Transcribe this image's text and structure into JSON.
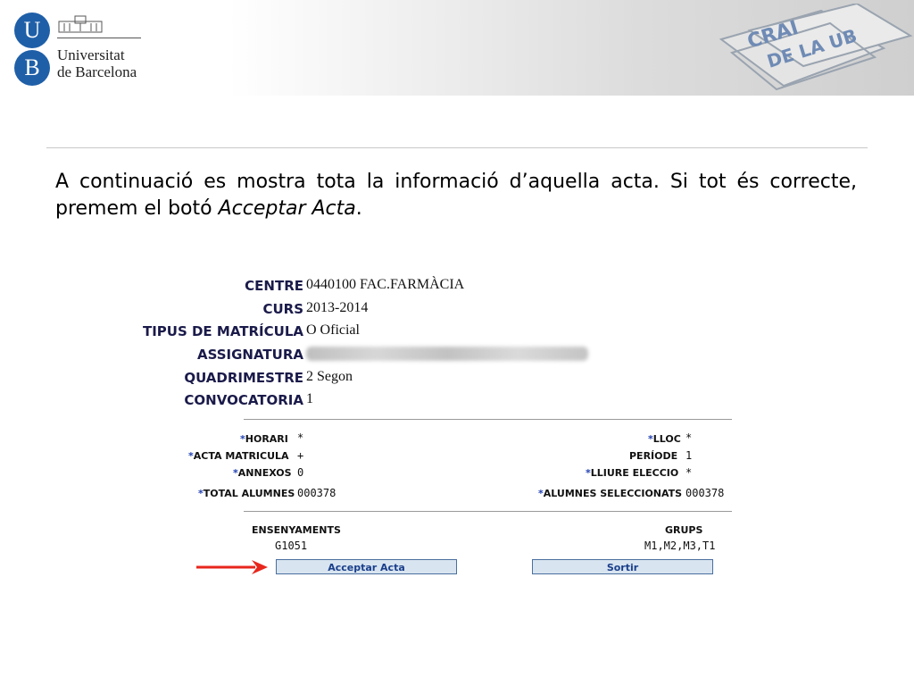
{
  "header": {
    "university_logo_letters": [
      "U",
      "B"
    ],
    "university_name_line1": "Universitat",
    "university_name_line2": "de Barcelona",
    "crai_logo": {
      "line1": "CRAI",
      "line2": "DE LA UB"
    }
  },
  "intro": {
    "text_before": "A continuació es mostra tota la informació d’aquella acta. Si tot és correcte, premem el botó ",
    "emphasis": "Acceptar Acta",
    "text_after": "."
  },
  "acta": {
    "centre_label": "CENTRE",
    "centre_value": "0440100 FAC.FARMÀCIA",
    "curs_label": "CURS",
    "curs_value": "2013-2014",
    "tipus_label": "TIPUS DE MATRÍCULA",
    "tipus_value": "O Oficial",
    "assignatura_label": "ASSIGNATURA",
    "quadrimestre_label": "QUADRIMESTRE",
    "quadrimestre_value": "2 Segon",
    "convocatoria_label": "CONVOCATORIA",
    "convocatoria_value": "1",
    "horari_label": "HORARI",
    "horari_value": "*",
    "lloc_label": "LLOC",
    "lloc_value": "*",
    "acta_matricula_label": "ACTA MATRICULA",
    "acta_matricula_value": "+",
    "periode_label": "PERÍODE",
    "periode_value": "1",
    "annexos_label": "ANNEXOS",
    "annexos_value": "0",
    "lliure_eleccio_label": "LLIURE ELECCIO",
    "lliure_eleccio_value": "*",
    "total_alumnes_label": "TOTAL ALUMNES",
    "total_alumnes_value": "000378",
    "alumnes_seleccionats_label": "ALUMNES SELECCIONATS",
    "alumnes_seleccionats_value": "000378",
    "ensenyaments_label": "ENSENYAMENTS",
    "ensenyaments_value": "G1051",
    "grups_label": "GRUPS",
    "grups_value": "M1,M2,M3,T1",
    "asterisk": "*"
  },
  "buttons": {
    "accept_label": "Acceptar Acta",
    "exit_label": "Sortir"
  },
  "colors": {
    "arrow": "#e8261c",
    "ub_blue": "#1f5fa8",
    "button_fill": "#d8e4f0"
  }
}
